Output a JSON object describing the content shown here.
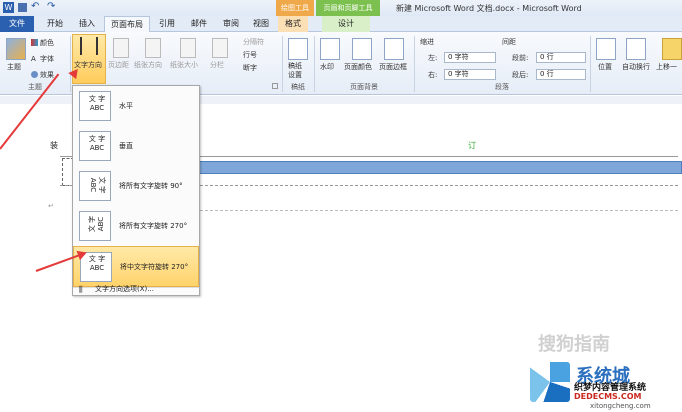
{
  "window": {
    "title": "新建 Microsoft Word 文档.docx - Microsoft Word",
    "context_tab_drawing": "绘图工具",
    "context_tab_table": "页眉和页脚工具"
  },
  "tabs": [
    "文件",
    "开始",
    "插入",
    "页面布局",
    "引用",
    "邮件",
    "审阅",
    "视图",
    "格式",
    "设计"
  ],
  "ribbon": {
    "theme": {
      "main": "主题",
      "colors": "颜色",
      "fonts": "字体",
      "effects": "效果",
      "group": "主题"
    },
    "page_setup": {
      "text_direction": "文字方向",
      "margins": "页边距",
      "orientation": "纸张方向",
      "size": "纸张大小",
      "columns": "分栏",
      "breaks": "分隔符",
      "line_numbers": "行号",
      "hyphenation": "断字"
    },
    "draft": {
      "settings": "稿纸\n设置",
      "group": "稿纸"
    },
    "page_background": {
      "watermark": "水印",
      "page_color": "页面颜色",
      "page_border": "页面边框",
      "group": "页面背景"
    },
    "paragraph": {
      "indent_label": "缩进",
      "spacing_label": "间距",
      "left_label": "左:",
      "left_value": "0 字符",
      "right_label": "右:",
      "right_value": "0 字符",
      "before_label": "段前:",
      "before_value": "0 行",
      "after_label": "段后:",
      "after_value": "0 行",
      "group": "段落"
    },
    "arrange": {
      "position": "位置",
      "wrap": "自动换行",
      "bring_forward": "上移一"
    }
  },
  "doc": {
    "header_left": "装",
    "header_center": "订"
  },
  "menu": {
    "items": [
      {
        "label": "水平",
        "thumb": "文字\nABC"
      },
      {
        "label": "垂直",
        "thumb": "文字\nABC"
      },
      {
        "label": "将所有文字旋转 90°",
        "thumb": "ABC 文字"
      },
      {
        "label": "将所有文字旋转 270°",
        "thumb": "文字 ABC"
      },
      {
        "label": "将中文字符旋转 270°",
        "thumb": "文字\nABC"
      }
    ],
    "options": "文字方向选项(X)..."
  },
  "watermark": {
    "sogou": "搜狗指南",
    "brand_top": "系统城",
    "brand_mid": "织梦内容管理系统",
    "brand_url": "DEDECMS.COM",
    "site": "xitongcheng.com"
  },
  "colors": {
    "accent_blue": "#2b5faf",
    "highlight": "#ffd36b",
    "arrow": "#e53a3a",
    "table_bar": "#7fa6d8"
  }
}
